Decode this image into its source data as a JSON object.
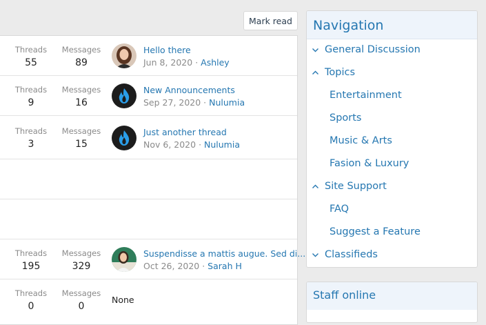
{
  "mark_read_label": "Mark read",
  "forums": [
    {
      "threads_label": "Threads",
      "threads": "55",
      "messages_label": "Messages",
      "messages": "89",
      "latest_title": "Hello there",
      "latest_date": "Jun 8, 2020",
      "latest_user": "Ashley",
      "avatar": "woman-photo"
    },
    {
      "threads_label": "Threads",
      "threads": "9",
      "messages_label": "Messages",
      "messages": "16",
      "latest_title": "New Announcements",
      "latest_date": "Sep 27, 2020",
      "latest_user": "Nulumia",
      "avatar": "flame-logo"
    },
    {
      "threads_label": "Threads",
      "threads": "3",
      "messages_label": "Messages",
      "messages": "15",
      "latest_title": "Just another thread",
      "latest_date": "Nov 6, 2020",
      "latest_user": "Nulumia",
      "avatar": "flame-logo"
    },
    {
      "threads_label": "Threads",
      "threads": "195",
      "messages_label": "Messages",
      "messages": "329",
      "latest_title": "Suspendisse a mattis augue. Sed di...",
      "latest_date": "Oct 26, 2020",
      "latest_user": "Sarah H",
      "avatar": "woman-photo-2"
    },
    {
      "threads_label": "Threads",
      "threads": "0",
      "messages_label": "Messages",
      "messages": "0",
      "latest_none": "None"
    }
  ],
  "meta_separator": " · ",
  "navigation": {
    "title": "Navigation",
    "items": [
      {
        "label": "General Discussion",
        "icon": "chevron-down-icon"
      },
      {
        "label": "Topics",
        "icon": "chevron-up-icon"
      },
      {
        "label": "Entertainment"
      },
      {
        "label": "Sports"
      },
      {
        "label": "Music & Arts"
      },
      {
        "label": "Fasion & Luxury"
      },
      {
        "label": "Site Support",
        "icon": "chevron-up-icon"
      },
      {
        "label": "FAQ"
      },
      {
        "label": "Suggest a Feature"
      },
      {
        "label": "Classifieds",
        "icon": "chevron-down-icon"
      }
    ]
  },
  "staff_online": {
    "title": "Staff online"
  },
  "colors": {
    "link": "#2577b1",
    "muted": "#8a8a8a",
    "header_bg": "#eef4fb"
  }
}
